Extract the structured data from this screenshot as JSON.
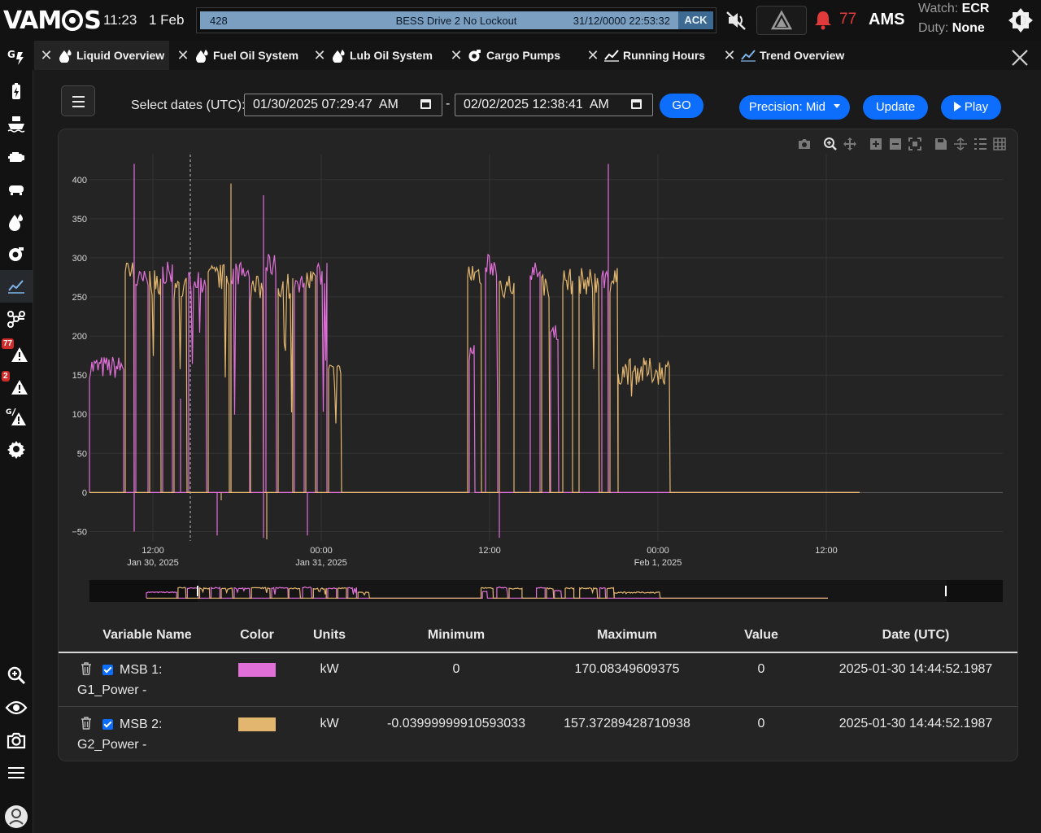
{
  "app": {
    "logo": "VAMOS",
    "clock": "11:23",
    "date": "1 Feb",
    "theme_icon": "sun-icon"
  },
  "alarm_banner": {
    "number": "428",
    "text": "BESS Drive 2 No Lockout",
    "timestamp": "31/12/0000 22:53:32",
    "ack_label": "ACK",
    "strip_color": "#7b9fc0"
  },
  "status": {
    "alarm_count": "77",
    "system": "AMS",
    "watch_label": "Watch:",
    "watch_value": "ECR",
    "duty_label": "Duty:",
    "duty_value": "None"
  },
  "sidebar": {
    "items": [
      {
        "icon": "generator-power-icon"
      },
      {
        "icon": "battery-icon"
      },
      {
        "icon": "ship-icon"
      },
      {
        "icon": "engine-icon"
      },
      {
        "icon": "pump-icon"
      },
      {
        "icon": "fuel-drop-icon"
      },
      {
        "icon": "cargo-pump-icon"
      },
      {
        "icon": "trend-chart-icon",
        "active": true
      },
      {
        "icon": "network-icon"
      },
      {
        "icon": "alarm-warning-icon",
        "badge": "77"
      },
      {
        "icon": "warning-icon",
        "badge": "2"
      },
      {
        "icon": "gen-warning-icon"
      },
      {
        "icon": "settings-icon"
      },
      {
        "icon": "zoom-search-icon"
      },
      {
        "icon": "eye-icon"
      },
      {
        "icon": "camera-icon"
      },
      {
        "icon": "menu-icon"
      },
      {
        "icon": "user-avatar-icon"
      }
    ]
  },
  "tabs": [
    {
      "label": "Liquid Overview",
      "icon": "fuel-drop-icon",
      "active": true
    },
    {
      "label": "Fuel Oil System",
      "icon": "fuel-drop-icon"
    },
    {
      "label": "Lub Oil System",
      "icon": "fuel-drop-icon"
    },
    {
      "label": "Cargo Pumps",
      "icon": "cargo-pump-icon"
    },
    {
      "label": "Running Hours",
      "icon": "trend-chart-icon"
    },
    {
      "label": "Trend Overview",
      "icon": "trend-chart-icon"
    }
  ],
  "toolbar": {
    "select_label": "Select dates (UTC):",
    "start": "01/30/2025 07:29:47  AM",
    "end": "02/02/2025 12:38:41  AM",
    "separator": "-",
    "go": "GO",
    "precision": "Precision: Mid",
    "update": "Update",
    "play": "Play"
  },
  "chart_data": {
    "type": "line",
    "y_ticks": [
      "400",
      "350",
      "300",
      "250",
      "200",
      "150",
      "100",
      "50",
      "0",
      "−50"
    ],
    "ylim": [
      -62,
      432
    ],
    "x_ticks": [
      {
        "label": "12:00",
        "sub": "Jan 30, 2025"
      },
      {
        "label": "00:00",
        "sub": "Jan 31, 2025"
      },
      {
        "label": "12:00",
        "sub": ""
      },
      {
        "label": "00:00",
        "sub": "Feb 1, 2025"
      },
      {
        "label": "12:00",
        "sub": ""
      }
    ],
    "grid": true,
    "legend": "none",
    "series": [
      {
        "name": "MSB 1: G1_Power -",
        "color": "#e070d8"
      },
      {
        "name": "MSB 2: G2_Power -",
        "color": "#e2b66e"
      }
    ]
  },
  "table": {
    "headers": [
      "Variable Name",
      "Color",
      "Units",
      "Minimum",
      "Maximum",
      "Value",
      "Date (UTC)"
    ],
    "rows": [
      {
        "name_l1": "MSB 1:",
        "name_l2": "G1_Power -",
        "color": "#e070d8",
        "units": "kW",
        "min": "0",
        "max": "170.08349609375",
        "value": "0",
        "date": "2025-01-30 14:44:52.1987"
      },
      {
        "name_l1": "MSB 2:",
        "name_l2": "G2_Power -",
        "color": "#e2b66e",
        "units": "kW",
        "min": "-0.03999999910593033",
        "max": "157.37289428710938",
        "value": "0",
        "date": "2025-01-30 14:44:52.1987"
      }
    ]
  }
}
